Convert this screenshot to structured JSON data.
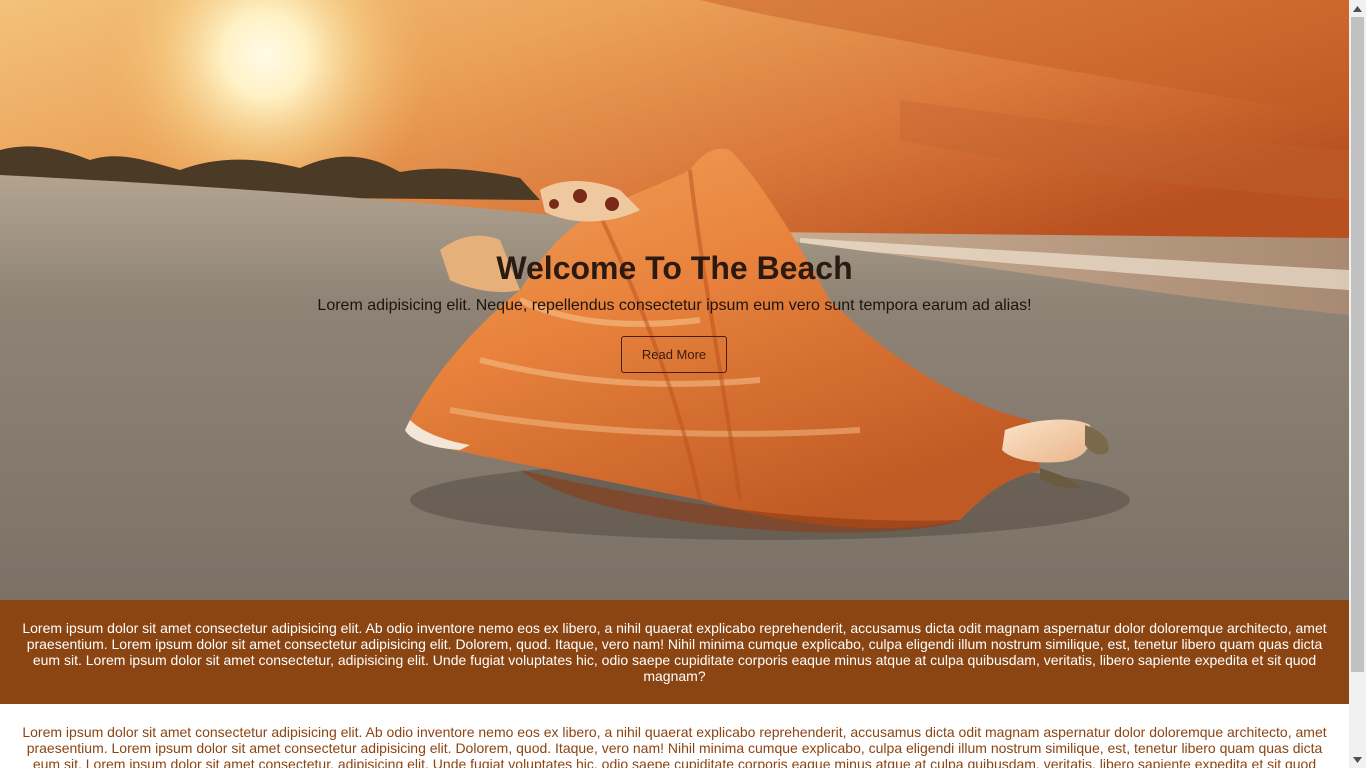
{
  "hero": {
    "title": "Welcome To The Beach",
    "subtitle": "Lorem adipisicing elit. Neque, repellendus consectetur ipsum eum vero sunt tempora earum ad alias!",
    "button_label": "Read More"
  },
  "band": {
    "text": "Lorem ipsum dolor sit amet consectetur adipisicing elit. Ab odio inventore nemo eos ex libero, a nihil quaerat explicabo reprehenderit, accusamus dicta odit magnam aspernatur dolor doloremque architecto, amet praesentium. Lorem ipsum dolor sit amet consectetur adipisicing elit. Dolorem, quod. Itaque, vero nam! Nihil minima cumque explicabo, culpa eligendi illum nostrum similique, est, tenetur libero quam quas dicta eum sit. Lorem ipsum dolor sit amet consectetur, adipisicing elit. Unde fugiat voluptates hic, odio saepe cupiditate corporis eaque minus atque at culpa quibusdam, veritatis, libero sapiente expedita et sit quod magnam?"
  },
  "plain": {
    "text": "Lorem ipsum dolor sit amet consectetur adipisicing elit. Ab odio inventore nemo eos ex libero, a nihil quaerat explicabo reprehenderit, accusamus dicta odit magnam aspernatur dolor doloremque architecto, amet praesentium. Lorem ipsum dolor sit amet consectetur adipisicing elit. Dolorem, quod. Itaque, vero nam! Nihil minima cumque explicabo, culpa eligendi illum nostrum similique, est, tenetur libero quam quas dicta eum sit. Lorem ipsum dolor sit amet consectetur, adipisicing elit. Unde fugiat voluptates hic, odio saepe cupiditate corporis eaque minus atque at culpa quibusdam, veritatis, libero sapiente expedita et sit quod magnam?"
  },
  "colors": {
    "band_bg": "#8b4513",
    "plain_text": "#8b4513",
    "band_text": "#ffffff"
  },
  "icons": {
    "scroll_up": "chevron-up-icon",
    "scroll_down": "chevron-down-icon"
  }
}
